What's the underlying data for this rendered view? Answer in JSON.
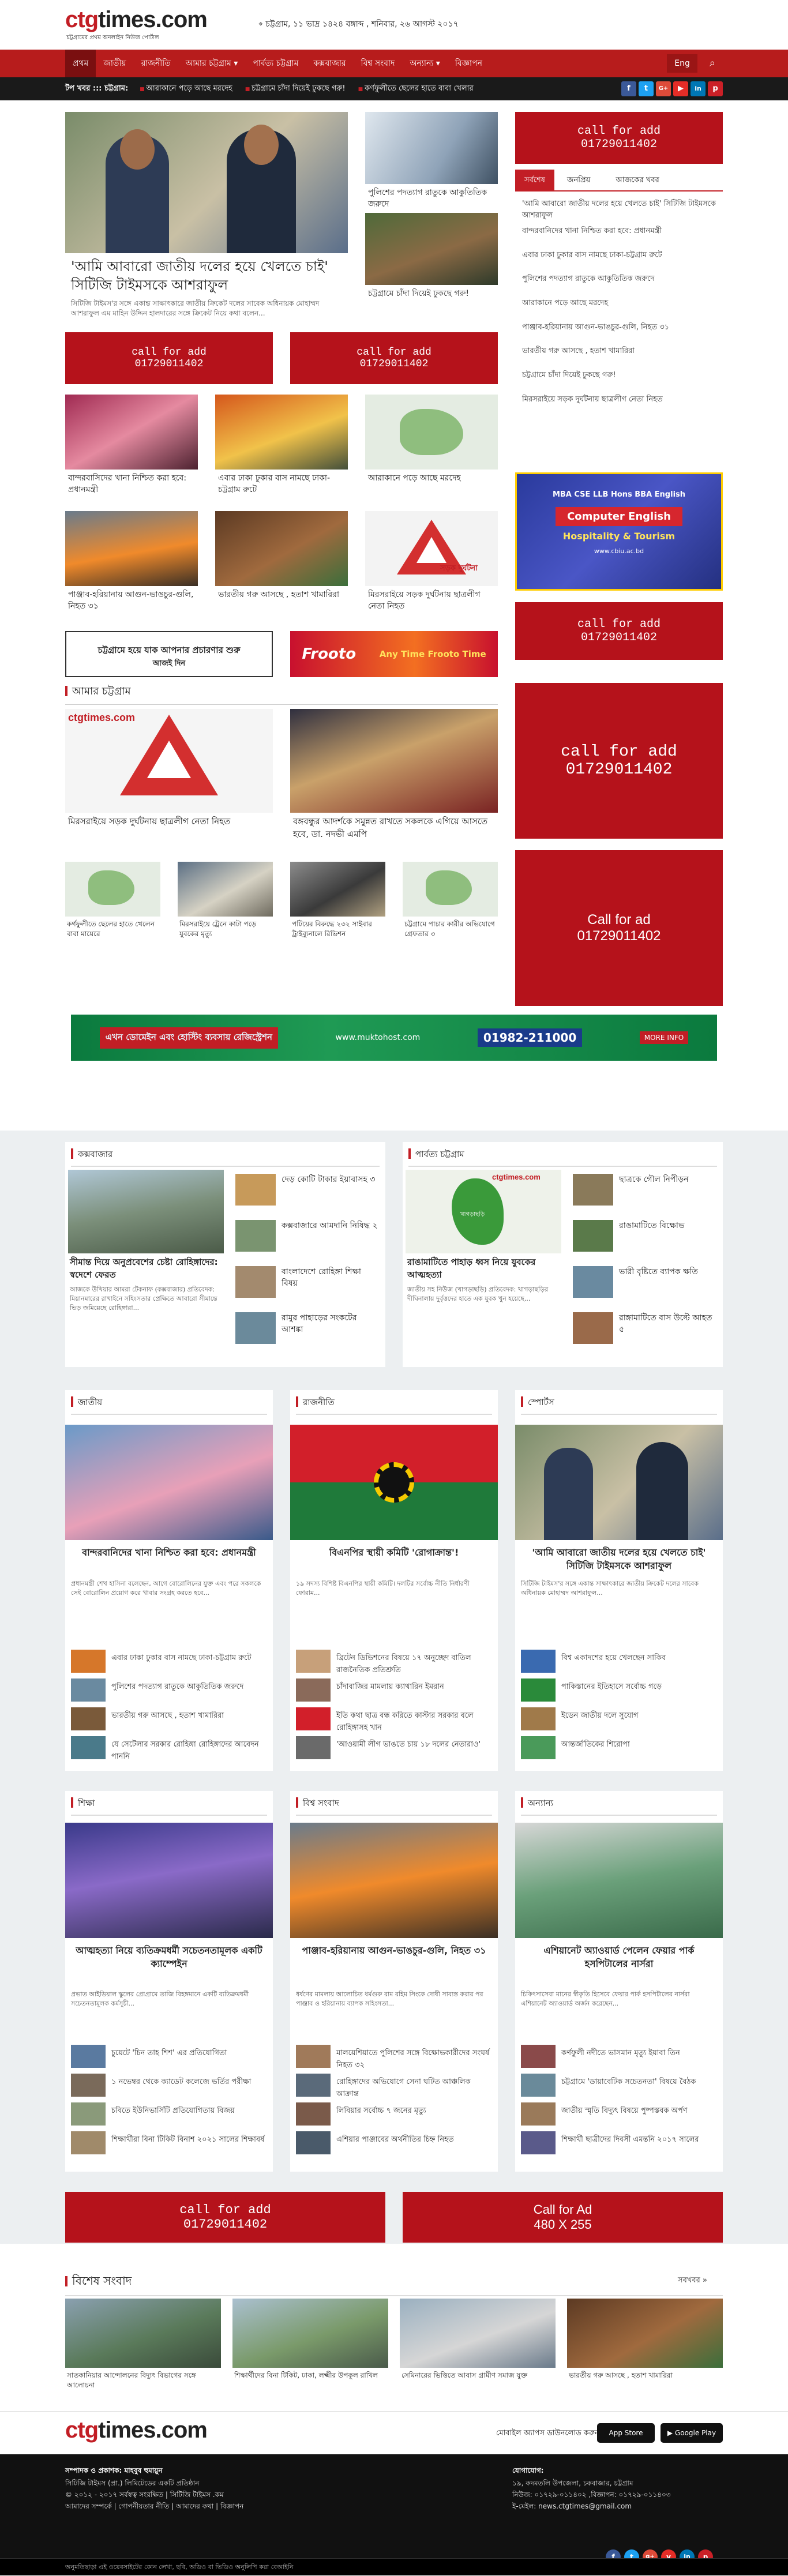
{
  "header": {
    "logo": "ctgtimes.com",
    "logo_red": "ctg",
    "logo_rest": "times.com",
    "logo_sub": "চট্টগ্রামের প্রথম অনলাইন নিউজ পোর্টাল",
    "date": "চট্টগ্রাম, ১১ ভাদ্র ১৪২৪ বঙ্গাব্দ , শনিবার, ২৬ আগস্ট ২০১৭"
  },
  "nav": {
    "items": [
      "প্রথম",
      "জাতীয়",
      "রাজনীতি",
      "আমার চট্টগ্রাম ▾",
      "পার্বত্য চট্টগ্রাম",
      "কক্সবাজার",
      "বিশ্ব সংবাদ",
      "অন্যান্য ▾",
      "বিজ্ঞাপন"
    ],
    "lang": "Eng"
  },
  "ticker": {
    "label": "টপ খবর ::: চট্টগ্রাম:",
    "items": [
      "আরাকানে পড়ে আছে মরদেহ",
      "চট্টগ্রামে চাঁদা দিয়েই ঢুকছে গরু!",
      "কর্ণফুলীতে ছেলের হাতে বাবা খেলার"
    ]
  },
  "lead": {
    "title": "'আমি আবারো জাতীয় দলের হয়ে খেলতে চাই' সিটিজি টাইমসকে আশরাফুল",
    "summary": "সিটিজি টাইমস'র সঙ্গে একান্ত সাক্ষাৎকারে জাতীয় ক্রিকেট দলের সাবেক অধিনায়ক মোহাম্মদ আশরাফুল এম মাহিন উদ্দিন হালদারের সঙ্গে ক্রিকেট নিয়ে কথা বলেন..."
  },
  "side_news": [
    {
      "t": "পুলিশের পদত্যাগ রাতুকে আকুতিতিক জরুদে"
    },
    {
      "t": "চট্টগ্রামে চাঁদা দিয়েই ঢুকছে গরু!"
    }
  ],
  "ad": {
    "line1": "call for add",
    "line2": "01729011402",
    "line3": "Call for ad",
    "line4": "01729011402",
    "line5": "Call for Ad",
    "line6": "480 X 255"
  },
  "tabs": {
    "t1": "সর্বশেষ",
    "t2": "জনপ্রিয়",
    "t3": "আজকের খবর"
  },
  "latest": [
    "'আমি আবারো জাতীয় দলের হয়ে খেলতে চাই' সিটিজি টাইমসকে আশরাফুল",
    "বান্দরবানিদের খানা নিশ্চিত করা হবে: প্রধানমন্ত্রী",
    "এবার ঢাকা ঢুকার বাস নামছে ঢাকা-চট্টগ্রাম রুটে",
    "পুলিশের পদত্যাগ রাতুকে আকুতিতিক জরুদে",
    "আরাকানে পড়ে আছে মরদেহ",
    "পাঞ্জাব-হরিয়ানায় আগুন-ভাঙচুর-গুলি, নিহত ৩১",
    "ভারতীয় গরু আসছে , হতাশ খামারিরা",
    "চট্টগ্রামে চাঁদা দিয়েই ঢুকছে গরু!",
    "মিরসরাইয়ে সড়ক দুর্ঘটনায় ছাত্রলীগ নেতা নিহত"
  ],
  "grid": [
    {
      "t": "বান্দরবাসিদের খানা নিশ্চিত করা হবে: প্রধানমন্ত্রী"
    },
    {
      "t": "এবার ঢাকা ঢুকার বাস নামছে ঢাকা-চট্টগ্রাম রুটে"
    },
    {
      "t": "আরাকানে পড়ে আছে মরদেহ"
    },
    {
      "t": "পাঞ্জাব-হরিয়ানায় আগুন-ভাঙচুর-গুলি, নিহত ৩১"
    },
    {
      "t": "ভারতীয় গরু আসছে , হতাশ খামারিরা"
    },
    {
      "t": "মিরসরাইয়ে সড়ক দুর্ঘটনায় ছাত্রলীগ নেতা নিহত"
    }
  ],
  "university_ad": {
    "line1": "MBA  CSE  LLB Hons  BBA English",
    "line2": "Computer   English",
    "line3": "Hospitality & Tourism",
    "line4": "www.cbiu.ac.bd"
  },
  "banner1": {
    "text": "চট্টগ্রামে হয়ে যাক আপনার প্রচারণার শুরু",
    "sub": "আজই দিন"
  },
  "banner2": {
    "brand": "Frooto",
    "text": "Any Time Frooto Time"
  },
  "section_ctg": {
    "title": "আমার চট্টগ্রাম",
    "items": [
      {
        "t": "মিরসরাইয়ে সড়ক দুর্ঘটনায় ছাত্রলীগ নেতা নিহত"
      },
      {
        "t": "বঙ্গবন্ধুর আদর্শকে সমুন্নত রাখতে সকলকে এগিয়ে আসতে হবে, ডা. নদভী এমপি"
      },
      {
        "t": "কর্ণফুলীতে ছেলের হাতে খেলেন বাবা মায়েরে"
      },
      {
        "t": "মিরসরাইয়ে ট্রেনে কাটা পড়ে যুবকের মৃত্যু"
      },
      {
        "t": "পটিয়ের বিরুদ্ধে ২৩২ সাইবার ট্রাইব্যুনালে রিভিশন"
      },
      {
        "t": "চট্টগ্রামে পাচার কারীর অভিযোগে গ্রেফতার ৩"
      }
    ],
    "stamp": "সড়ক দুর্ঘটনা"
  },
  "hosting_ad": {
    "text": "এখন ডোমেইন এবং হোস্টিং ব্যবসায় রেজিস্ট্রেশন",
    "url": "www.muktohost.com",
    "phone": "01982-211000",
    "more": "MORE INFO"
  },
  "cox": {
    "title": "কক্সবাজার",
    "lead": "সীমান্ত দিয়ে অনুপ্রবেশের চেষ্টা রোহিঙ্গাদের: স্বদেশে ফেরত",
    "lead_sum": "আজকে উখিয়ার আমরা টেকনাফ (কক্সবাজার) প্রতিবেদক: মিয়ানমারের রাখাইনে সহিংসতার প্রেক্ষিতে আবারো সীমান্তে ভিড় জমিয়েছে রোহিঙ্গারা...",
    "side": [
      "দেড় কোটি টাকার ইয়াবাসহ ৩",
      "কক্সবাজারে আমদানি নিষিদ্ধ ২",
      "বাংলাদেশে রোহিঙ্গা শিক্ষা বিষয়",
      "রামুর পাহাড়ের সংকটের আশঙ্কা"
    ]
  },
  "hill": {
    "title": "পার্বত্য চট্টগ্রাম",
    "lead": "রাঙামাটিতে পাহাড় ধ্বস নিয়ে যুবকের আত্মহত্যা",
    "lead_sum": "জাতীয় সহ নিউজ (খাগড়াছড়ি) প্রতিবেদক: খাগড়াছড়ির দীঘিনালায় দুর্বৃত্তদের হাতে এক যুবক খুন হয়েছে...",
    "map_label": "খাগড়াছড়ি",
    "side": [
      "ছাত্রকে গৌল নিপীড়ন",
      "রাঙামাটিতে বিক্ষোভ",
      "ভারী বৃষ্টিতে ব্যাপক ক্ষতি",
      "রাঙ্গামাটিতে বাস উল্টে আহত ৫"
    ]
  },
  "national": {
    "title": "জাতীয়",
    "lead": "বান্দরবানিদের খানা নিশ্চিত করা হবে: প্রধানমন্ত্রী",
    "sum": "প্রধানমন্ত্রী শেখ হাসিনা বলেছেন, আগে বোরোলিনের যুক্ত এবং পরে সকলকে সেই বোরোলিন প্রয়োগ করে খাবার সংগ্রহ করতে হবে...",
    "list": [
      "এবার ঢাকা ঢুকার বাস নামছে ঢাকা-চট্টগ্রাম রুটে",
      "পুলিশের পদত্যাগ রাতুকে আকুতিতিক জরুদে",
      "ভারতীয় গরু আসছে , হতাশ খামারিরা",
      "যে সেটেলার সরকার রোহিঙ্গা রোহিঙ্গাদের আবেদন পাননি"
    ]
  },
  "politics": {
    "title": "রাজনীতি",
    "lead": "বিএনপির স্থায়ী কমিটি 'রোগাক্রান্ত'!",
    "sum": "১৯ সদস্য বিশিষ্ট বিএনপির স্থায়ী কমিটি। দলটির সর্বোচ্চ নীতি নির্ধারণী ফোরাম...",
    "list": [
      "ব্রিটেন ডিভিশনের বিষয়ে ১৭ অনুচ্ছেদ বাতিল রাজনৈতিক প্রতিশ্রুতি",
      "চাঁদাবাজির মামলায় ক্যাথারিন ইমরান",
      "ইতি কথা ছাত্র বন্ধ করিতে কাস্টার সরকার বলে রোহিঙ্গাসহ খান",
      "'আওয়ামী লীগ ভাঙতে চায় ১৮ দলের নেতারাও'"
    ]
  },
  "sports": {
    "title": "স্পোর্টস",
    "lead": "'আমি আবারো জাতীয় দলের হয়ে খেলতে চাই' সিটিজি টাইমসকে আশরাফুল",
    "sum": "সিটিজি টাইমস'র সঙ্গে একান্ত সাক্ষাৎকারে জাতীয় ক্রিকেট দলের সাবেক অধিনায়ক মোহাম্মদ আশরাফুল...",
    "list": [
      "বিশ্ব একাদশের হয়ে খেলছেন সাকিব",
      "পাকিস্তানের ইতিহাসে সর্বোচ্চ গড়ে",
      "ইডেন জাতীয় দলে সুযোগ",
      "আন্তর্জাতিকের শিরোপা"
    ]
  },
  "edu": {
    "title": "শিক্ষা",
    "lead": "আত্মহত্যা নিয়ে ব্যতিক্রমধর্মী সচেতনতামূলক একটি ক্যাম্পেইন",
    "sum": "প্রভাত আইডিয়াল স্কুলের প্রোগ্রামে তাজি বিহঙ্গমানে একটি ব্যতিক্রমধর্মী সচেতনতামূলক কর্মসূচী...",
    "list": [
      "চুয়েটে 'চিন তাহ শিশ' এর প্রতিযোগিতা",
      "১ নভেম্বর থেকে ক্যাডেট কলেজে ভর্তির পরীক্ষা",
      "চবিতে ইউনিভার্সিটি প্রতিযোগিতায় বিজয়",
      "শিক্ষার্থীরা বিনা টিকিট বিনাশ ২০২১ সালের শিক্ষাবর্ষ"
    ]
  },
  "world": {
    "title": "বিশ্ব সংবাদ",
    "lead": "পাঞ্জাব-হরিয়ানায় আগুন-ভাঙচুর-গুলি, নিহত ৩১",
    "sum": "ধর্ষণের মামলায় আলোচিত ধর্মগুরু রাম রহিম সিংকে দোষী সাব্যস্ত করার পর পাঞ্জাব ও হরিয়ানায় ব্যাপক সহিংসতা...",
    "list": [
      "মালয়েশিয়াতে পুলিশের সঙ্গে বিক্ষোভকারীদের সংঘর্ষ নিহত ৩২",
      "রোহিঙ্গাদের অভিযোগে সেনা ঘটিত আঞ্চলিক আক্রান্ত",
      "লিবিয়ার সর্বোচ্চ ৭ জনের মৃত্যু",
      "এশিয়ার পাঞ্জাবের অর্থনীতির চিহ্ন নিহত"
    ]
  },
  "other": {
    "title": "অন্যান্য",
    "lead": "এশিয়ানেট অ্যাওয়ার্ড পেলেন ফেয়ার পার্ক হসপিটালের নার্সরা",
    "sum": "চিকিৎসাসেবা মানের স্বীকৃতি হিসেবে ফেয়ার পার্ক হসপিটালের নার্সরা এশিয়ানেট অ্যাওয়ার্ড অর্জন করেছেন...",
    "list": [
      "কর্ণফুলী নদীতে ভাসমান মৃত্যু ইয়াবা তিন",
      "চট্টগ্রামে 'ডায়াবেটিক সচেতনতা' বিষয়ে বৈঠক",
      "জাতীয় স্মৃতি বিদ্যুৎ বিষয়ে পুষ্পস্তবক অর্পণ",
      "শিক্ষার্থী ছাত্রীদের দিবসী এমন্তনি ২০১৭ সালের"
    ]
  },
  "special": {
    "title": "বিশেষ সংবাদ",
    "all": "সবখবর »",
    "items": [
      "সাতকানিয়ার আন্দোলনের বিদ্যুৎ বিভাগের সঙ্গে আলোচনা",
      "শিক্ষার্থীদের বিনা টিকিট, ঢাকা, লক্ষ্মীর উপকূল রাখিল",
      "সেমিনারের ভিত্তিতে আবাস গ্রামীণ সমাজ যুক্ত",
      "ভারতীয় গরু আসছে , হতাশ খামারিরা"
    ]
  },
  "footer": {
    "logo": "ctgtimes.com",
    "app_text": "মোবাইল অ্যাপস ডাউনলোড করুন",
    "appstore": "App Store",
    "play": "Google Play",
    "editor": "সম্পাদক ও প্রকাশক: মাহবুব হুমায়ুন",
    "left2": "সিটিজি টাইমস (প্রা.) লিমিটেডের একটি প্রতিষ্ঠান",
    "left3": "© ২০১২ - ২০১৭ সর্বস্বত্ব সংরক্ষিত | সিটিজি টাইমস .কম",
    "left4": "আমাদের সম্পর্কে | গোপনীয়তার নীতি | আমাদের কথা | বিজ্ঞাপন",
    "office": "যোগাযোগ:",
    "addr": "১৯, কদমতলি উপজেলা, চকবাজার, চট্টগ্রাম",
    "phone": "নিউজ: ০১৭২৯-০১১৪০২ ,বিজ্ঞাপন: ০১৭২৯-০১১৪০৩",
    "email": "ই-মেইল: news.ctgtimes@gmail.com",
    "bottom": "অনুমতিছাড়া এই ওয়েবসাইটের কোন লেখা, ছবি, অডিও বা ভিডিও অনুলিপি করা বেআইনি",
    "social": [
      "f",
      "t",
      "g+",
      "y",
      "in",
      "p"
    ]
  },
  "colors": {
    "brand": "#c21e25",
    "nav": "#b71c1c",
    "ad": "#b5121b"
  }
}
